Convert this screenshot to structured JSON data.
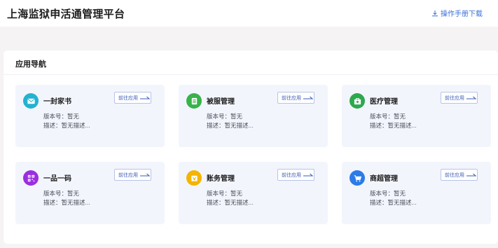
{
  "header": {
    "title": "上海监狱申活通管理平台",
    "manual_link": "操作手册下载"
  },
  "nav_card": {
    "title": "应用导航"
  },
  "colors": {
    "accent": "#3a6fd8",
    "tile_bg": "#f3f5fd"
  },
  "apps": [
    {
      "name": "一封家书",
      "icon": "envelope-icon",
      "icon_color": "#22b3cf",
      "button": "前往应用",
      "version_label": "版本号：",
      "version": "暂无",
      "desc_label": "描述：",
      "desc": "暂无描述..."
    },
    {
      "name": "被服管理",
      "icon": "list-doc-icon",
      "icon_color": "#37b34a",
      "button": "前往应用",
      "version_label": "版本号：",
      "version": "暂无",
      "desc_label": "描述：",
      "desc": "暂无描述..."
    },
    {
      "name": "医疗管理",
      "icon": "medical-kit-icon",
      "icon_color": "#2ea84e",
      "button": "前往应用",
      "version_label": "版本号：",
      "version": "暂无",
      "desc_label": "描述：",
      "desc": "暂无描述..."
    },
    {
      "name": "一品一码",
      "icon": "qr-code-icon",
      "icon_color": "#9b2fe0",
      "button": "前往应用",
      "version_label": "版本号：",
      "version": "暂无",
      "desc_label": "描述：",
      "desc": "暂无描述..."
    },
    {
      "name": "账务管理",
      "icon": "wallet-icon",
      "icon_color": "#f4b400",
      "button": "前往应用",
      "version_label": "版本号：",
      "version": "暂无",
      "desc_label": "描述：",
      "desc": "暂无描述..."
    },
    {
      "name": "商超管理",
      "icon": "shopping-cart-icon",
      "icon_color": "#2b7be8",
      "button": "前往应用",
      "version_label": "版本号：",
      "version": "暂无",
      "desc_label": "描述：",
      "desc": "暂无描述..."
    }
  ]
}
